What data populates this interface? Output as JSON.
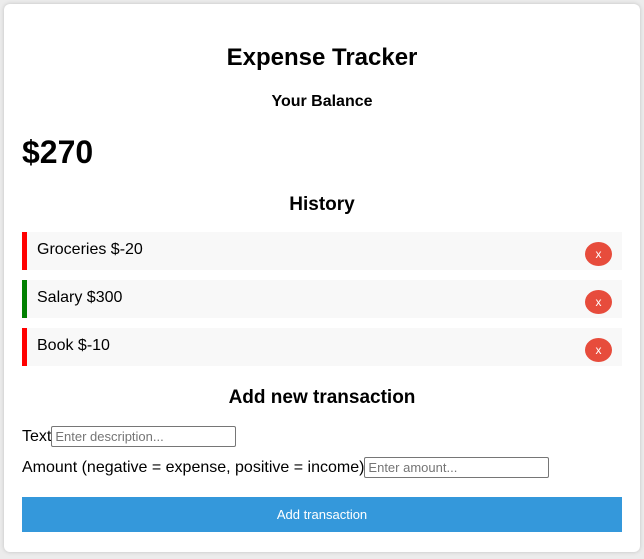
{
  "app": {
    "title": "Expense Tracker"
  },
  "balance": {
    "label": "Your Balance",
    "amount": "$270"
  },
  "history": {
    "title": "History",
    "items": [
      {
        "text": "Groceries $-20",
        "delete_label": "x",
        "type": "minus"
      },
      {
        "text": "Salary $300",
        "delete_label": "x",
        "type": "plus"
      },
      {
        "text": "Book $-10",
        "delete_label": "x",
        "type": "minus"
      }
    ]
  },
  "form": {
    "title": "Add new transaction",
    "text_label": "Text",
    "text_placeholder": "Enter description...",
    "text_value": "",
    "amount_label": "Amount (negative = expense, positive = income)",
    "amount_placeholder": "Enter amount...",
    "amount_value": "",
    "submit_label": "Add transaction"
  },
  "colors": {
    "expense": "#ff0000",
    "income": "#008000",
    "delete_button": "#e74c3c",
    "primary_button": "#3498db"
  }
}
